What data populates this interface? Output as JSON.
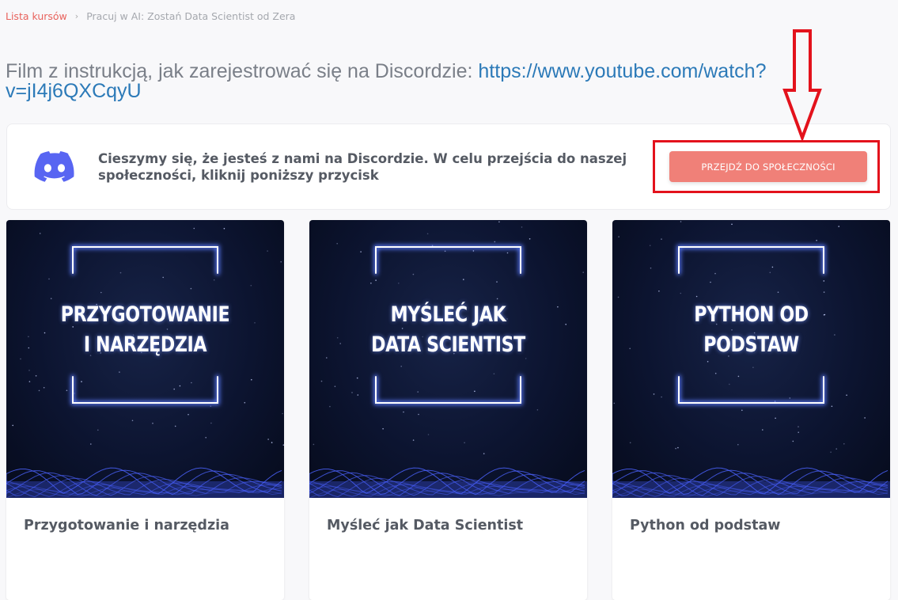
{
  "breadcrumb": {
    "root": "Lista kursów",
    "separator": "›",
    "current": "Pracuj w AI: Zostań Data Scientist od Zera"
  },
  "intro": {
    "text": "Film z instrukcją, jak zarejestrować się na Discordzie: ",
    "link": "https://www.youtube.com/watch?v=jI4j6QXCqyU"
  },
  "discord": {
    "icon": "discord-icon",
    "message": "Cieszymy się, że jesteś z nami na Discordzie. W celu przejścia do naszej społeczności, kliknij poniższy przycisk",
    "button_label": "PRZEJDŹ DO SPOŁECZNOŚCI",
    "button_color": "#f08078",
    "annotation_color": "#e3121c"
  },
  "courses": [
    {
      "image_text": "PRZYGOTOWANIE\nI NARZĘDZIA",
      "title": "Przygotowanie i narzędzia"
    },
    {
      "image_text": "MYŚLEĆ JAK\nDATA SCIENTIST",
      "title": "Myśleć jak Data Scientist"
    },
    {
      "image_text": "PYTHON OD\nPODSTAW",
      "title": "Python od podstaw"
    }
  ]
}
